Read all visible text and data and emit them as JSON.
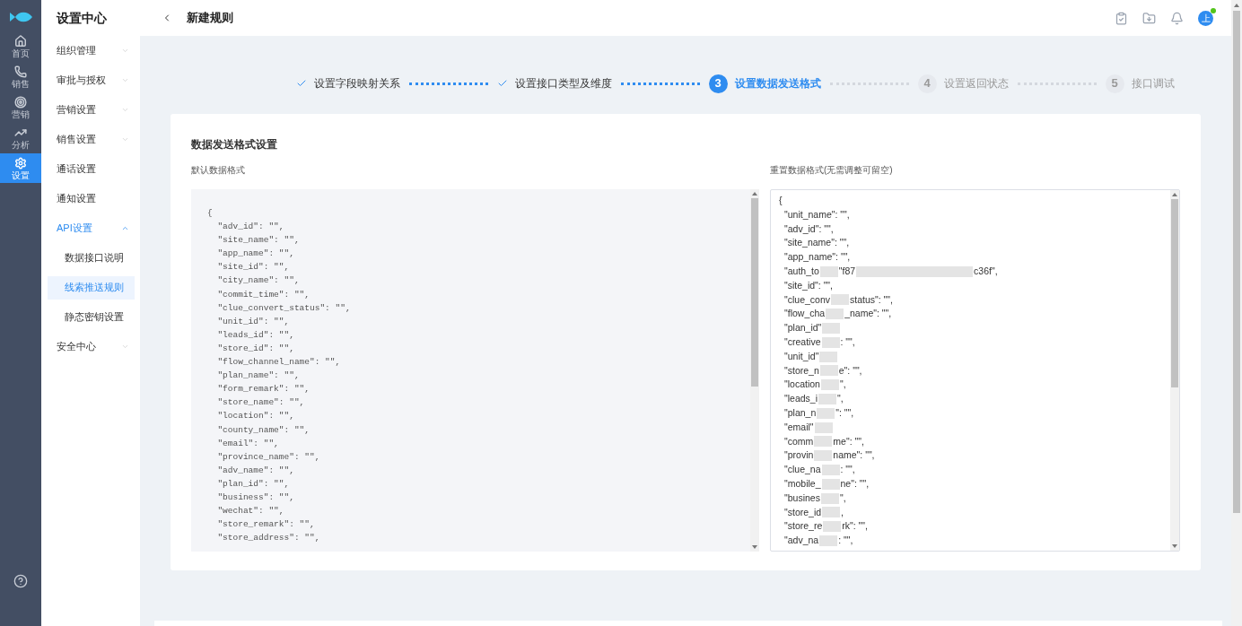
{
  "rail": [
    {
      "label": "首页",
      "selected": false
    },
    {
      "label": "销售",
      "selected": false
    },
    {
      "label": "营销",
      "selected": false
    },
    {
      "label": "分析",
      "selected": false
    },
    {
      "label": "设置",
      "selected": true
    }
  ],
  "sidebar": {
    "title": "设置中心",
    "items": [
      {
        "label": "组织管理",
        "expanded": false,
        "selected": false
      },
      {
        "label": "审批与授权",
        "expanded": false,
        "selected": false
      },
      {
        "label": "营销设置",
        "expanded": false,
        "selected": false
      },
      {
        "label": "销售设置",
        "expanded": false,
        "selected": false
      },
      {
        "label": "通话设置",
        "selected": false
      },
      {
        "label": "通知设置",
        "selected": false
      },
      {
        "label": "API设置",
        "expanded": true,
        "selected": true,
        "children": [
          {
            "label": "数据接口说明",
            "selected": false
          },
          {
            "label": "线索推送规则",
            "selected": true
          },
          {
            "label": "静态密钥设置",
            "selected": false
          }
        ]
      },
      {
        "label": "安全中心",
        "expanded": false,
        "selected": false
      }
    ]
  },
  "header": {
    "title": "新建规则",
    "avatar": "上",
    "notification": true
  },
  "steps": [
    {
      "label": "设置字段映射关系",
      "completed": true,
      "selected": false
    },
    {
      "label": "设置接口类型及维度",
      "completed": true,
      "selected": false
    },
    {
      "number": "3",
      "label": "设置数据发送格式",
      "completed": false,
      "selected": true
    },
    {
      "number": "4",
      "label": "设置返回状态",
      "completed": false,
      "selected": false
    },
    {
      "number": "5",
      "label": "接口调试",
      "completed": false,
      "selected": false
    }
  ],
  "card": {
    "title": "数据发送格式设置",
    "default_format": {
      "label": "默认数据格式",
      "lines": [
        "{",
        "  \"adv_id\": \"\",",
        "  \"site_name\": \"\",",
        "  \"app_name\": \"\",",
        "  \"site_id\": \"\",",
        "  \"city_name\": \"\",",
        "  \"commit_time\": \"\",",
        "  \"clue_convert_status\": \"\",",
        "  \"unit_id\": \"\",",
        "  \"leads_id\": \"\",",
        "  \"store_id\": \"\",",
        "  \"flow_channel_name\": \"\",",
        "  \"plan_name\": \"\",",
        "  \"form_remark\": \"\",",
        "  \"store_name\": \"\",",
        "  \"location\": \"\",",
        "  \"county_name\": \"\",",
        "  \"email\": \"\",",
        "  \"province_name\": \"\",",
        "  \"adv_name\": \"\",",
        "  \"plan_id\": \"\",",
        "  \"business\": \"\",",
        "  \"wechat\": \"\",",
        "  \"store_remark\": \"\",",
        "  \"store_address\": \"\","
      ]
    },
    "custom_format": {
      "label": "重置数据格式(无需调整可留空)",
      "lines": [
        {
          "parts": [
            "{"
          ],
          "blurred_end": false
        },
        {
          "parts": [
            "\"unit_name\": \"\","
          ],
          "blurred_end": false
        },
        {
          "parts": [
            "\"adv_id\": \"\","
          ],
          "blurred_end": false
        },
        {
          "parts": [
            "\"site_name\": \"\","
          ],
          "blurred_end": false
        },
        {
          "parts": [
            "\"app_name\": \"\","
          ],
          "blurred_end": false
        },
        {
          "parts": [
            "\"auth_to",
            "\"f87",
            "c36f\","
          ],
          "blurred_end": false
        },
        {
          "parts": [
            "\"site_id\": \"\","
          ],
          "blurred_end": false
        },
        {
          "parts": [
            "\"clue_conv",
            "status\": \"\","
          ],
          "blurred_end": false
        },
        {
          "parts": [
            "\"flow_cha",
            "_name\": \"\","
          ],
          "blurred_end": false
        },
        {
          "parts": [
            "\"plan_id\""
          ],
          "blurred_end": true
        },
        {
          "parts": [
            "\"creative",
            ": \"\","
          ],
          "blurred_end": false
        },
        {
          "parts": [
            "\"unit_id\""
          ],
          "blurred_end": true
        },
        {
          "parts": [
            "\"store_n",
            "e\": \"\","
          ],
          "blurred_end": false
        },
        {
          "parts": [
            "\"location",
            "\","
          ],
          "blurred_end": false
        },
        {
          "parts": [
            "\"leads_i",
            "\","
          ],
          "blurred_end": false
        },
        {
          "parts": [
            "\"plan_n",
            "\": \"\","
          ],
          "blurred_end": false
        },
        {
          "parts": [
            "\"email\""
          ],
          "blurred_end": true
        },
        {
          "parts": [
            "\"comm",
            "me\": \"\","
          ],
          "blurred_end": false
        },
        {
          "parts": [
            "\"provin",
            "name\": \"\","
          ],
          "blurred_end": false
        },
        {
          "parts": [
            "\"clue_na",
            ": \"\","
          ],
          "blurred_end": false
        },
        {
          "parts": [
            "\"mobile_",
            "ne\": \"\","
          ],
          "blurred_end": false
        },
        {
          "parts": [
            "\"busines",
            "\","
          ],
          "blurred_end": false
        },
        {
          "parts": [
            "\"store_id",
            ","
          ],
          "blurred_end": false
        },
        {
          "parts": [
            "\"store_re",
            "rk\": \"\","
          ],
          "blurred_end": false
        },
        {
          "parts": [
            "\"adv_na",
            ": \"\","
          ],
          "blurred_end": false
        }
      ]
    }
  }
}
